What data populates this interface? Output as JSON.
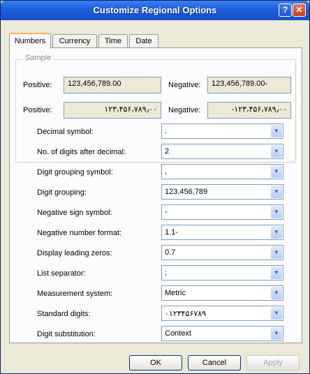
{
  "window": {
    "title": "Customize Regional Options",
    "help_glyph": "?",
    "close_glyph": "✕"
  },
  "tabs": [
    {
      "label": "Numbers",
      "active": true
    },
    {
      "label": "Currency",
      "active": false
    },
    {
      "label": "Time",
      "active": false
    },
    {
      "label": "Date",
      "active": false
    }
  ],
  "sample": {
    "title": "Sample",
    "positive_label": "Positive:",
    "negative_label": "Negative:",
    "positive_value": "123,456,789.00",
    "negative_value": "123,456,789.00-",
    "positive_value_native": "۱۲۳،۴۵۶،۷۸۹٫۰۰",
    "negative_value_native": "-۱۲۳،۴۵۶،۷۸۹٫۰۰"
  },
  "settings": [
    {
      "label": "Decimal symbol:",
      "value": "."
    },
    {
      "label": "No. of digits after decimal:",
      "value": "2"
    },
    {
      "label": "Digit grouping symbol:",
      "value": ","
    },
    {
      "label": "Digit grouping:",
      "value": "123,456,789"
    },
    {
      "label": "Negative sign symbol:",
      "value": "-"
    },
    {
      "label": "Negative number format:",
      "value": "1.1-"
    },
    {
      "label": "Display leading zeros:",
      "value": "0.7"
    },
    {
      "label": "List separator:",
      "value": ";"
    },
    {
      "label": "Measurement system:",
      "value": "Metric"
    },
    {
      "label": "Standard digits:",
      "value": "۰۱۲۳۴۵۶۷۸۹"
    },
    {
      "label": "Digit substitution:",
      "value": "Context"
    }
  ],
  "buttons": {
    "ok": "OK",
    "cancel": "Cancel",
    "apply": "Apply"
  },
  "colors": {
    "titlebar": "#1c5fd8",
    "window_bg": "#ece9d8",
    "tab_highlight": "#f7b64a"
  }
}
